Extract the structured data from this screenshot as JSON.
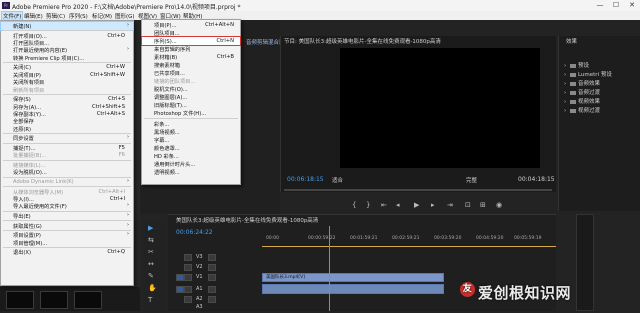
{
  "window": {
    "title": "Adobe Premiere Pro 2020 - F:\\文档\\Adobe\\Premiere Pro\\14.0\\视频项目.prproj *",
    "controls": {
      "minimize": "—",
      "maximize": "☐",
      "close": "✕"
    }
  },
  "menubar": [
    "文件(F)",
    "编辑(E)",
    "剪辑(C)",
    "序列(S)",
    "标记(M)",
    "图形(G)",
    "视图(V)",
    "窗口(W)",
    "帮助(H)"
  ],
  "file_menu": [
    {
      "label": "新建(N)",
      "shortcut": "",
      "submenu": true,
      "highlight": true
    },
    {
      "sep": true
    },
    {
      "label": "打开项目(O)...",
      "shortcut": "Ctrl+O"
    },
    {
      "label": "打开团队项目...",
      "shortcut": ""
    },
    {
      "label": "打开最近使用的内容(E)",
      "shortcut": "",
      "submenu": true
    },
    {
      "label": "转换 Premiere Clip 项目(C)...",
      "shortcut": ""
    },
    {
      "sep": true
    },
    {
      "label": "关闭(C)",
      "shortcut": "Ctrl+W"
    },
    {
      "label": "关闭项目(P)",
      "shortcut": "Ctrl+Shift+W"
    },
    {
      "label": "关闭所有项目",
      "shortcut": ""
    },
    {
      "label": "刷新所有项目",
      "shortcut": "",
      "disabled": true
    },
    {
      "sep": true
    },
    {
      "label": "保存(S)",
      "shortcut": "Ctrl+S"
    },
    {
      "label": "另存为(A)...",
      "shortcut": "Ctrl+Shift+S"
    },
    {
      "label": "保存副本(Y)...",
      "shortcut": "Ctrl+Alt+S"
    },
    {
      "label": "全部保存",
      "shortcut": ""
    },
    {
      "label": "还原(R)",
      "shortcut": ""
    },
    {
      "sep": true
    },
    {
      "label": "同步设置",
      "shortcut": "",
      "submenu": true
    },
    {
      "sep": true
    },
    {
      "label": "捕捉(T)...",
      "shortcut": "F5"
    },
    {
      "label": "批量捕捉(B)...",
      "shortcut": "F6",
      "disabled": true
    },
    {
      "sep": true
    },
    {
      "label": "链接媒体(L)...",
      "shortcut": "",
      "disabled": true
    },
    {
      "label": "设为脱机(O)...",
      "shortcut": ""
    },
    {
      "sep": true
    },
    {
      "label": "Adobe Dynamic Link(K)",
      "shortcut": "",
      "submenu": true,
      "disabled": true
    },
    {
      "sep": true
    },
    {
      "label": "从媒体浏览器导入(M)",
      "shortcut": "Ctrl+Alt+I",
      "disabled": true
    },
    {
      "label": "导入(I)...",
      "shortcut": "Ctrl+I"
    },
    {
      "label": "导入最近使用的文件(F)",
      "shortcut": "",
      "submenu": true
    },
    {
      "sep": true
    },
    {
      "label": "导出(E)",
      "shortcut": "",
      "submenu": true
    },
    {
      "sep": true
    },
    {
      "label": "获取属性(G)",
      "shortcut": "",
      "submenu": true
    },
    {
      "sep": true
    },
    {
      "label": "项目设置(P)",
      "shortcut": "",
      "submenu": true
    },
    {
      "label": "项目管理(M)...",
      "shortcut": ""
    },
    {
      "sep": true
    },
    {
      "label": "退出(X)",
      "shortcut": "Ctrl+Q"
    }
  ],
  "new_submenu": [
    {
      "label": "项目(P)...",
      "shortcut": "Ctrl+Alt+N"
    },
    {
      "label": "团队项目...",
      "shortcut": ""
    },
    {
      "label": "序列(S)...",
      "shortcut": "Ctrl+N",
      "boxed": true
    },
    {
      "label": "来自剪辑的序列",
      "shortcut": ""
    },
    {
      "label": "素材箱(B)",
      "shortcut": "Ctrl+B"
    },
    {
      "label": "搜索素材箱",
      "shortcut": ""
    },
    {
      "label": "已共享项目...",
      "shortcut": ""
    },
    {
      "label": "链接的团队项目...",
      "shortcut": "",
      "disabled": true
    },
    {
      "label": "脱机文件(O)...",
      "shortcut": ""
    },
    {
      "label": "调整图层(A)...",
      "shortcut": ""
    },
    {
      "label": "旧版标题(T)...",
      "shortcut": ""
    },
    {
      "label": "Photoshop 文件(H)...",
      "shortcut": ""
    },
    {
      "sep": true
    },
    {
      "label": "彩条...",
      "shortcut": ""
    },
    {
      "label": "黑场视频...",
      "shortcut": ""
    },
    {
      "label": "字幕...",
      "shortcut": ""
    },
    {
      "label": "颜色遮罩...",
      "shortcut": ""
    },
    {
      "label": "HD 彩条...",
      "shortcut": ""
    },
    {
      "label": "通用倒计时片头...",
      "shortcut": ""
    },
    {
      "label": "透明视频...",
      "shortcut": ""
    }
  ],
  "workspace_tabs": [
    "音频剪辑混合器: 美国队长3..."
  ],
  "program_monitor": {
    "title": "节目: 美国队长3:超级英雄电影片-全集在线免费观看-1080p高清",
    "timecode_left": "00:06:18:15",
    "fit": "适合",
    "quality": "完整",
    "timecode_right": "00:04:18:15"
  },
  "effects_panel": {
    "title": "效果",
    "items": [
      "预设",
      "Lumetri 预设",
      "音频效果",
      "音频过渡",
      "视频效果",
      "视频过渡"
    ]
  },
  "timeline": {
    "title": "美国队长3:超级英雄电影片-全集在线免费观看-1080p高清",
    "timecode": "00:06:24:22",
    "ruler": [
      "00:00",
      "00:00:59:22",
      "00:01:59:21",
      "00:02:59:21",
      "00:03:59:20",
      "00:04:59:20",
      "00:05:59:19"
    ],
    "tracks": [
      {
        "name": "V3"
      },
      {
        "name": "V2"
      },
      {
        "name": "V1",
        "clip": "美国队长3.mp4[V]"
      },
      {
        "name": "A1",
        "clip": ""
      },
      {
        "name": "A2"
      },
      {
        "name": "A3"
      }
    ]
  },
  "tools": [
    "▶",
    "⇆",
    "✂",
    "↔",
    "✎",
    "✋",
    "T"
  ],
  "watermark": {
    "logo": "友",
    "text": "爱创根知识网"
  },
  "colors": {
    "accent": "#4a9de5",
    "menu_bg": "#f2f2f2",
    "highlight": "#cde8ff",
    "box": "#d23a3a"
  }
}
